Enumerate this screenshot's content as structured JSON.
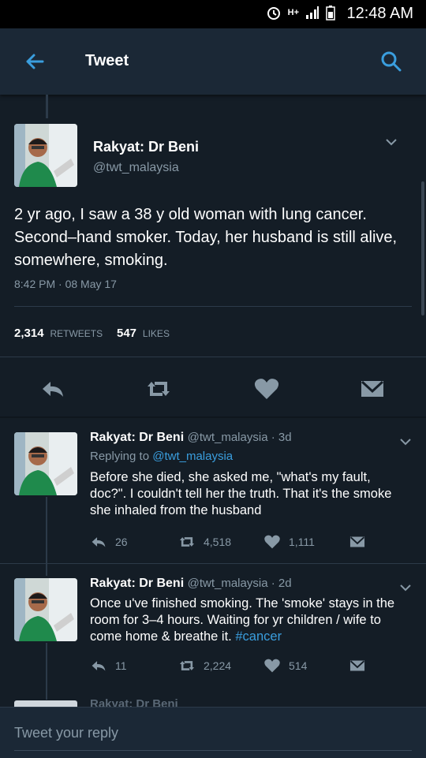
{
  "status_bar": {
    "time": "12:48 AM",
    "network": "H+"
  },
  "appbar": {
    "title": "Tweet"
  },
  "tweet": {
    "name": "Rakyat: Dr Beni",
    "handle": "@twt_malaysia",
    "text": "2 yr ago, I saw a 38 y old woman with lung cancer. Second–hand smoker. Today, her husband is still alive, somewhere, smoking.",
    "datetime": "8:42 PM · 08 May 17",
    "retweets": "2,314",
    "retweets_label": "RETWEETS",
    "likes": "547",
    "likes_label": "LIKES"
  },
  "replies": [
    {
      "name": "Rakyat: Dr Beni",
      "meta": "@twt_malaysia · 3d",
      "replying_prefix": "Replying to",
      "replying_to": "@twt_malaysia",
      "text": "Before she died, she asked me, \"what's my fault, doc?\". I couldn't tell her the truth. That it's the smoke she inhaled from the husband",
      "reply_count": "26",
      "retweet_count": "4,518",
      "like_count": "1,111"
    },
    {
      "name": "Rakyat: Dr Beni",
      "meta": "@twt_malaysia · 2d",
      "text": "Once u've finished smoking. The 'smoke' stays in the room for 3–4 hours. Waiting for yr children / wife to come home & breathe it.",
      "hashtag": "#cancer",
      "reply_count": "11",
      "retweet_count": "2,224",
      "like_count": "514"
    }
  ],
  "peek": {
    "text": "Rakyat: Dr Beni"
  },
  "composer": {
    "placeholder": "Tweet your reply"
  },
  "colors": {
    "background": "#141d26",
    "bar": "#1b2836",
    "accent": "#3a9ede",
    "muted": "#8899a6"
  },
  "icons": [
    "back-arrow-icon",
    "search-icon",
    "chevron-down-icon",
    "reply-icon",
    "retweet-icon",
    "heart-icon",
    "message-icon",
    "alarm-icon",
    "signal-icon",
    "battery-icon"
  ]
}
